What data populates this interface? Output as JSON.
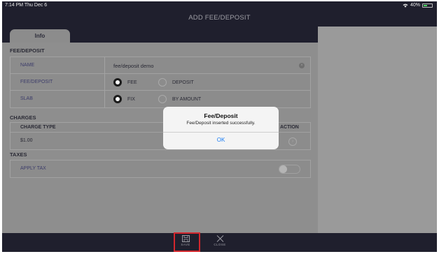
{
  "status_bar": {
    "time": "7:14 PM  Thu Dec 6",
    "battery": "40%"
  },
  "nav": {
    "title": "ADD FEE/DEPOSIT"
  },
  "tabs": [
    {
      "label": "Info",
      "selected": true
    }
  ],
  "fee_deposit_section": {
    "header": "FEE/DEPOSIT",
    "name": {
      "label": "NAME",
      "value": "fee/deposit demo"
    },
    "type": {
      "label": "FEE/DEPOSIT",
      "options": [
        "FEE",
        "DEPOSIT"
      ],
      "selected": "FEE"
    },
    "slab": {
      "label": "SLAB",
      "options": [
        "FIX",
        "BY AMOUNT"
      ],
      "selected": "FIX"
    }
  },
  "charges_section": {
    "header": "CHARGES",
    "columns": [
      "CHARGE TYPE",
      "ACTION"
    ],
    "rows": [
      {
        "charge_type": "$1.00"
      }
    ]
  },
  "taxes_section": {
    "header": "TAXES",
    "apply_tax": {
      "label": "APPLY TAX",
      "on": false
    }
  },
  "toolbar": {
    "save_label": "SAVE",
    "close_label": "CLOSE"
  },
  "alert": {
    "title": "Fee/Deposit",
    "message": "Fee/Deposit inserted successfully.",
    "ok_label": "OK"
  },
  "colors": {
    "accent": "#1a7cf5",
    "highlight": "#d3262d",
    "navbar": "#1f1f2d"
  }
}
